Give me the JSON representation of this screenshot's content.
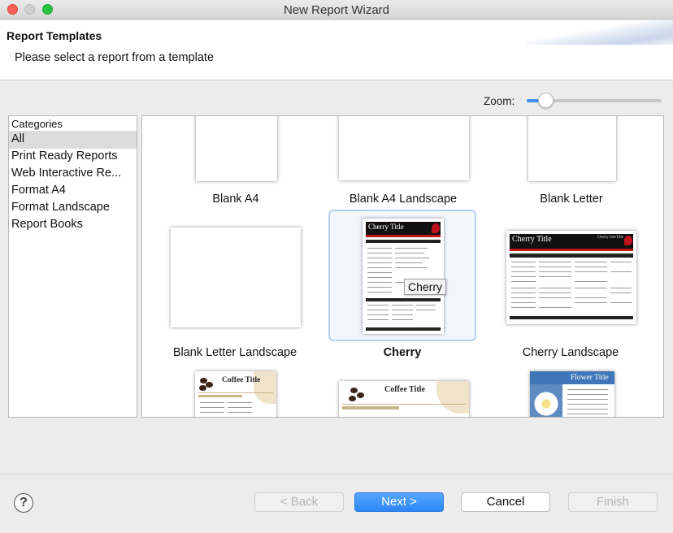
{
  "window": {
    "title": "New Report Wizard"
  },
  "header": {
    "title": "Report Templates",
    "description": "Please select a report from a template"
  },
  "zoom": {
    "label": "Zoom:",
    "level": 0.1
  },
  "categories": {
    "header": "Categories",
    "items": [
      {
        "label": "All",
        "selected": true
      },
      {
        "label": "Print Ready Reports",
        "selected": false
      },
      {
        "label": "Web Interactive Re...",
        "selected": false
      },
      {
        "label": "Format A4",
        "selected": false
      },
      {
        "label": "Format Landscape",
        "selected": false
      },
      {
        "label": "Report Books",
        "selected": false
      }
    ]
  },
  "templates": [
    {
      "label": "Blank A4",
      "selected": false
    },
    {
      "label": "Blank A4 Landscape",
      "selected": false
    },
    {
      "label": "Blank Letter",
      "selected": false
    },
    {
      "label": "Blank Letter Landscape",
      "selected": false
    },
    {
      "label": "Cherry",
      "selected": true
    },
    {
      "label": "Cherry Landscape",
      "selected": false
    }
  ],
  "thumbnails": {
    "cherry_title": "Cherry Title",
    "cherry_subtitle": "Cherry SubTitle",
    "coffee_title": "Coffee Title",
    "flower_title": "Flower Title"
  },
  "tooltip": "Cherry",
  "buttons": {
    "help": "?",
    "back": "< Back",
    "next": "Next >",
    "cancel": "Cancel",
    "finish": "Finish"
  },
  "colors": {
    "accent": "#2c86f5",
    "cherry_red": "#c0141c",
    "selection_border": "#b6d1ee"
  }
}
